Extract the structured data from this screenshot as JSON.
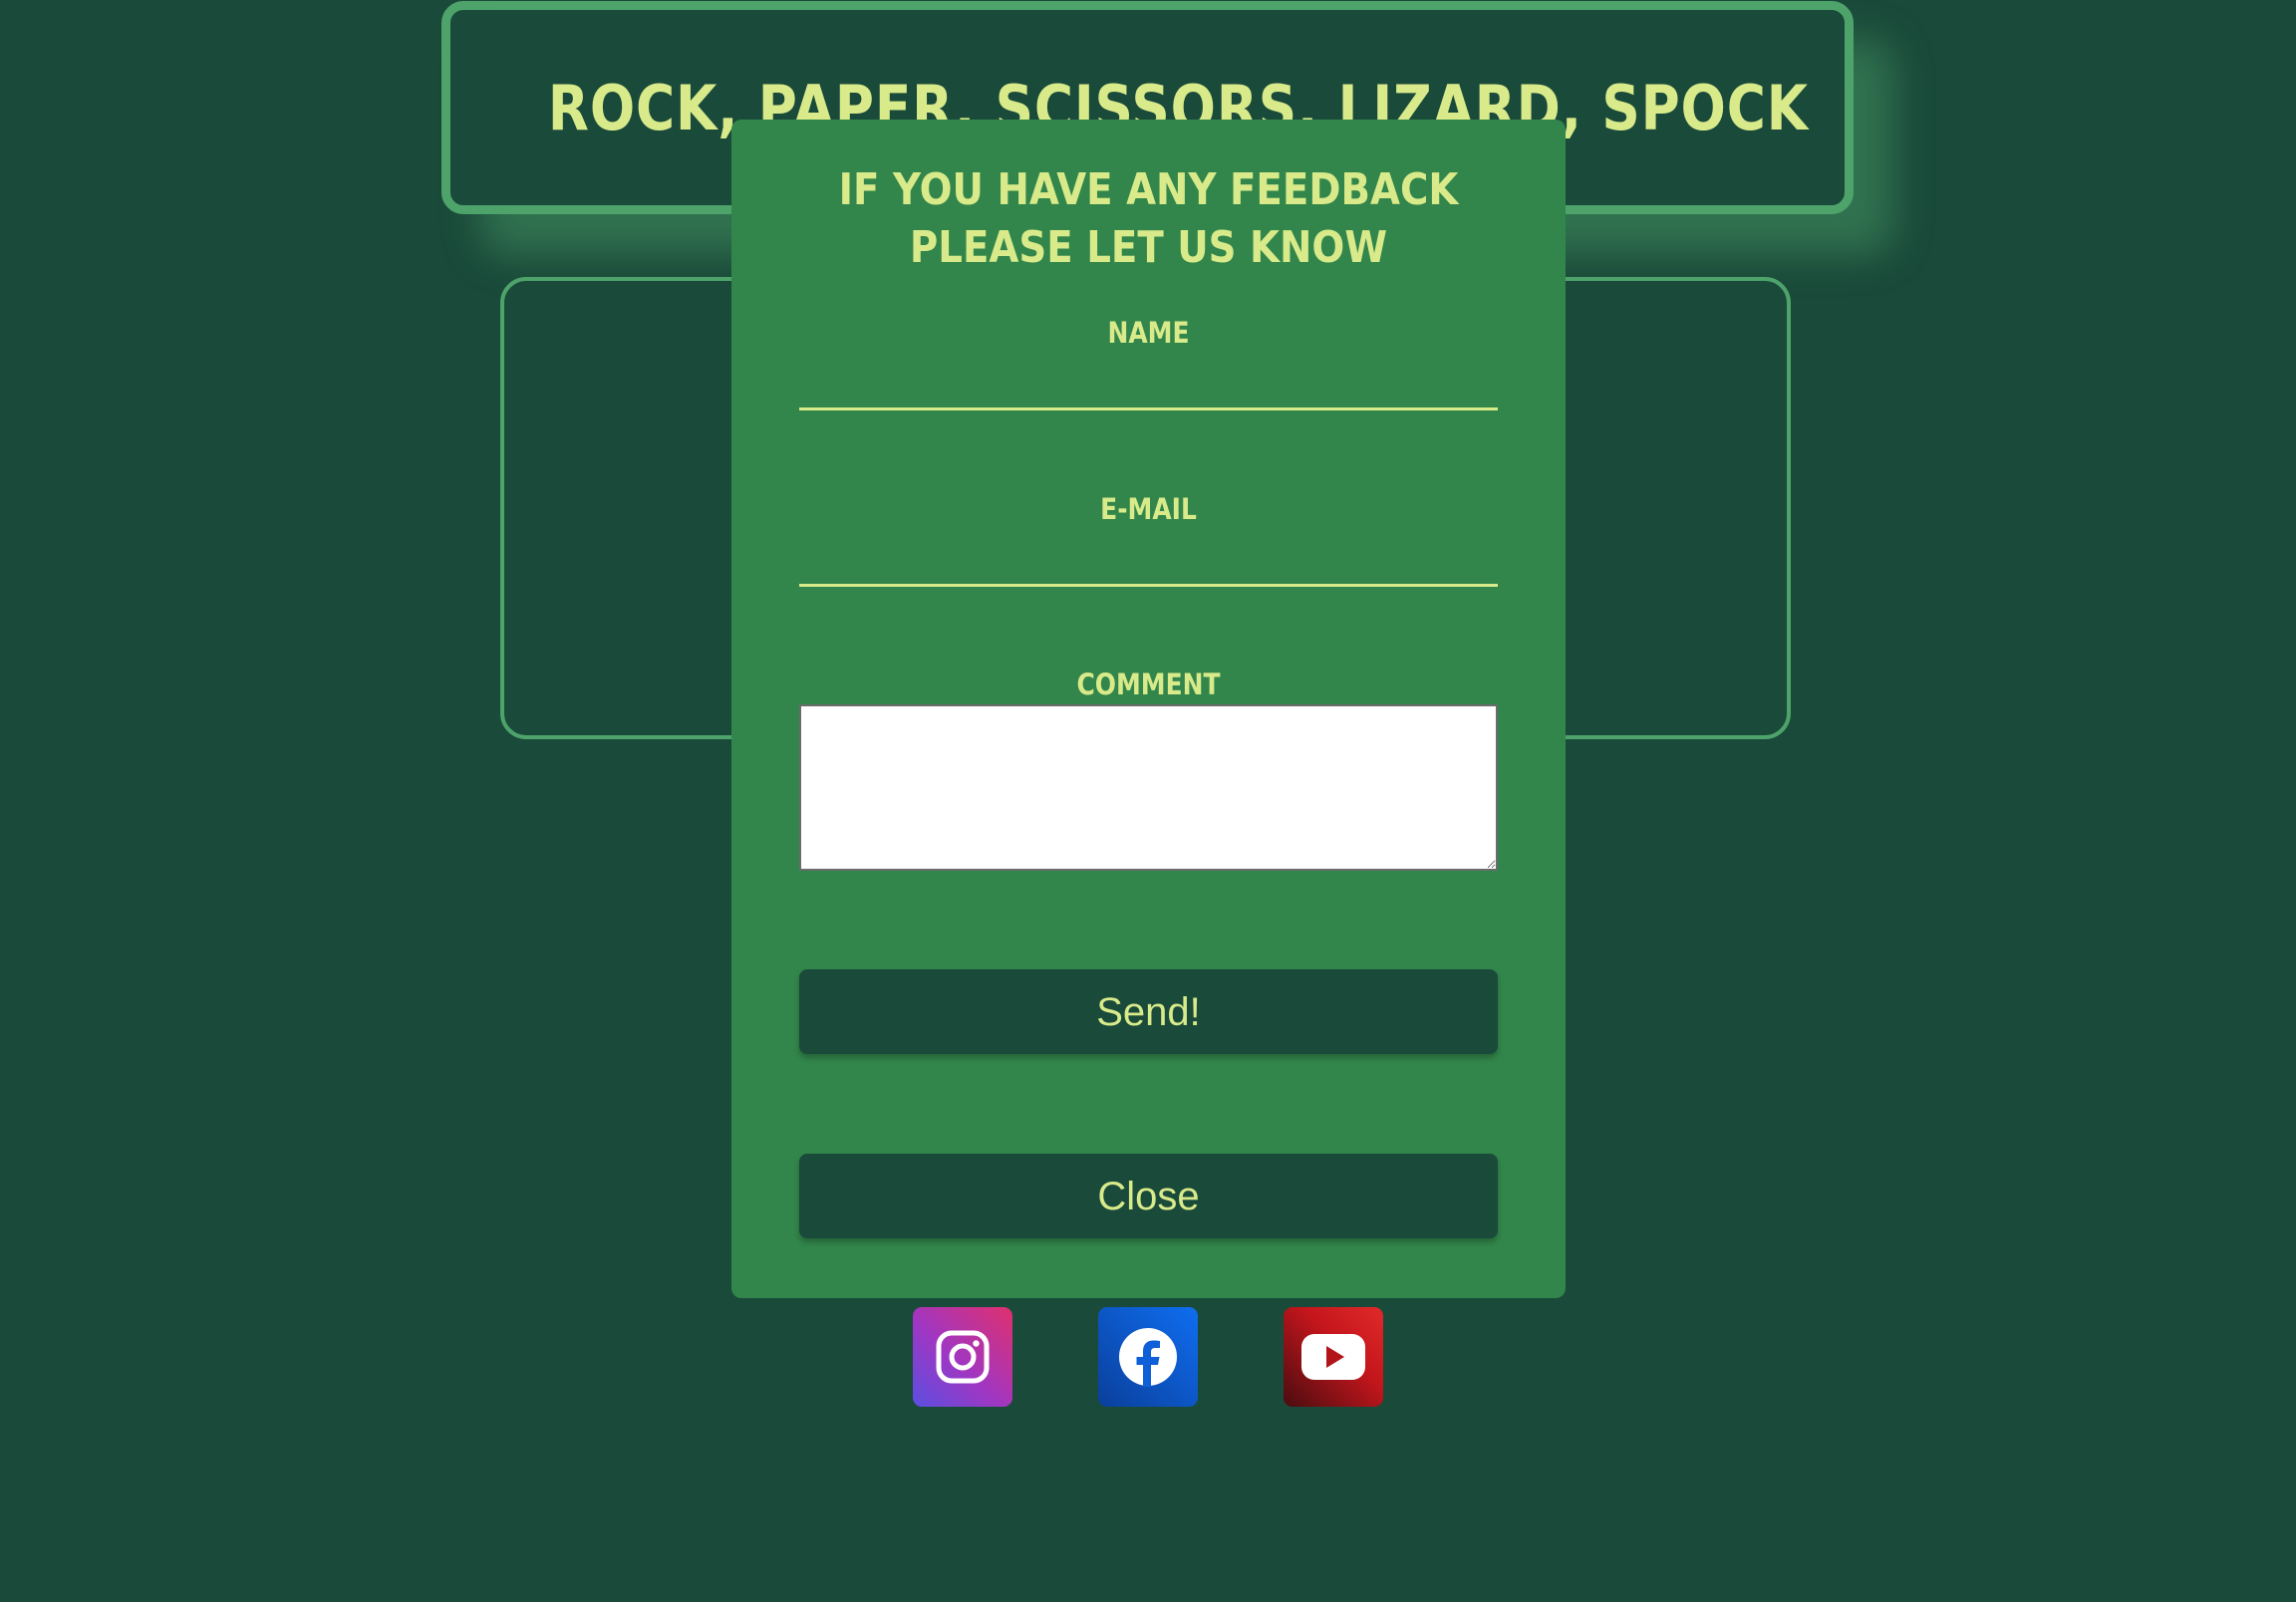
{
  "header": {
    "title": "ROCK, PAPER, SCISSORS, LIZARD, SPOCK"
  },
  "feedback": {
    "heading": "IF YOU HAVE ANY FEEDBACK PLEASE LET US KNOW",
    "name_label": "NAME",
    "name_value": "",
    "email_label": "E-MAIL",
    "email_value": "",
    "comment_label": "COMMENT",
    "comment_value": "",
    "send_label": "Send!",
    "close_label": "Close"
  },
  "social": {
    "items": [
      {
        "icon": "instagram-icon"
      },
      {
        "icon": "facebook-icon"
      },
      {
        "icon": "youtube-icon"
      }
    ]
  },
  "colors": {
    "background": "#1a4a3a",
    "modal": "#32864b",
    "accent_text": "#d8ea8a",
    "border": "#4ea36b"
  }
}
